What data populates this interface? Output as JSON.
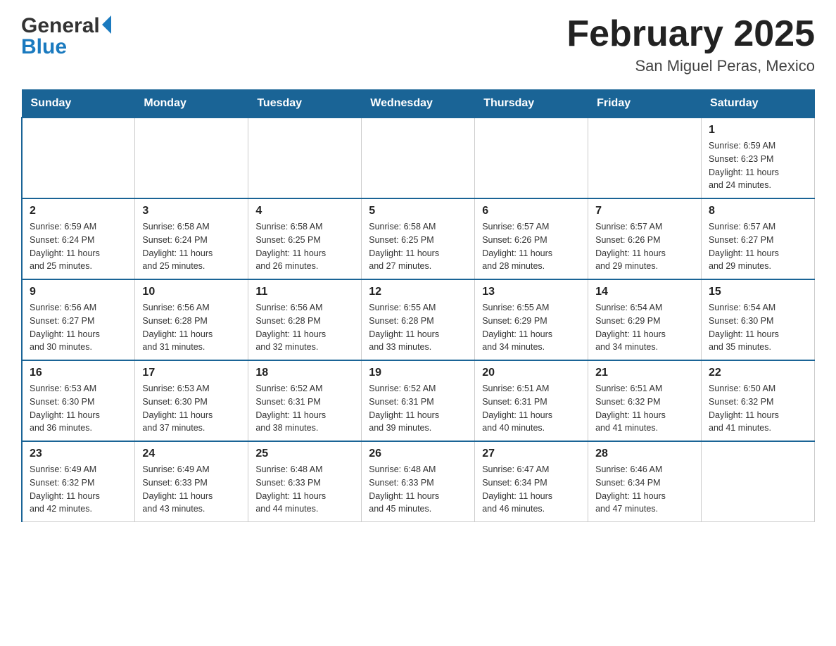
{
  "header": {
    "logo": {
      "general": "General",
      "blue": "Blue"
    },
    "title": "February 2025",
    "location": "San Miguel Peras, Mexico"
  },
  "calendar": {
    "days_of_week": [
      "Sunday",
      "Monday",
      "Tuesday",
      "Wednesday",
      "Thursday",
      "Friday",
      "Saturday"
    ],
    "weeks": [
      [
        {
          "day": "",
          "info": ""
        },
        {
          "day": "",
          "info": ""
        },
        {
          "day": "",
          "info": ""
        },
        {
          "day": "",
          "info": ""
        },
        {
          "day": "",
          "info": ""
        },
        {
          "day": "",
          "info": ""
        },
        {
          "day": "1",
          "info": "Sunrise: 6:59 AM\nSunset: 6:23 PM\nDaylight: 11 hours\nand 24 minutes."
        }
      ],
      [
        {
          "day": "2",
          "info": "Sunrise: 6:59 AM\nSunset: 6:24 PM\nDaylight: 11 hours\nand 25 minutes."
        },
        {
          "day": "3",
          "info": "Sunrise: 6:58 AM\nSunset: 6:24 PM\nDaylight: 11 hours\nand 25 minutes."
        },
        {
          "day": "4",
          "info": "Sunrise: 6:58 AM\nSunset: 6:25 PM\nDaylight: 11 hours\nand 26 minutes."
        },
        {
          "day": "5",
          "info": "Sunrise: 6:58 AM\nSunset: 6:25 PM\nDaylight: 11 hours\nand 27 minutes."
        },
        {
          "day": "6",
          "info": "Sunrise: 6:57 AM\nSunset: 6:26 PM\nDaylight: 11 hours\nand 28 minutes."
        },
        {
          "day": "7",
          "info": "Sunrise: 6:57 AM\nSunset: 6:26 PM\nDaylight: 11 hours\nand 29 minutes."
        },
        {
          "day": "8",
          "info": "Sunrise: 6:57 AM\nSunset: 6:27 PM\nDaylight: 11 hours\nand 29 minutes."
        }
      ],
      [
        {
          "day": "9",
          "info": "Sunrise: 6:56 AM\nSunset: 6:27 PM\nDaylight: 11 hours\nand 30 minutes."
        },
        {
          "day": "10",
          "info": "Sunrise: 6:56 AM\nSunset: 6:28 PM\nDaylight: 11 hours\nand 31 minutes."
        },
        {
          "day": "11",
          "info": "Sunrise: 6:56 AM\nSunset: 6:28 PM\nDaylight: 11 hours\nand 32 minutes."
        },
        {
          "day": "12",
          "info": "Sunrise: 6:55 AM\nSunset: 6:28 PM\nDaylight: 11 hours\nand 33 minutes."
        },
        {
          "day": "13",
          "info": "Sunrise: 6:55 AM\nSunset: 6:29 PM\nDaylight: 11 hours\nand 34 minutes."
        },
        {
          "day": "14",
          "info": "Sunrise: 6:54 AM\nSunset: 6:29 PM\nDaylight: 11 hours\nand 34 minutes."
        },
        {
          "day": "15",
          "info": "Sunrise: 6:54 AM\nSunset: 6:30 PM\nDaylight: 11 hours\nand 35 minutes."
        }
      ],
      [
        {
          "day": "16",
          "info": "Sunrise: 6:53 AM\nSunset: 6:30 PM\nDaylight: 11 hours\nand 36 minutes."
        },
        {
          "day": "17",
          "info": "Sunrise: 6:53 AM\nSunset: 6:30 PM\nDaylight: 11 hours\nand 37 minutes."
        },
        {
          "day": "18",
          "info": "Sunrise: 6:52 AM\nSunset: 6:31 PM\nDaylight: 11 hours\nand 38 minutes."
        },
        {
          "day": "19",
          "info": "Sunrise: 6:52 AM\nSunset: 6:31 PM\nDaylight: 11 hours\nand 39 minutes."
        },
        {
          "day": "20",
          "info": "Sunrise: 6:51 AM\nSunset: 6:31 PM\nDaylight: 11 hours\nand 40 minutes."
        },
        {
          "day": "21",
          "info": "Sunrise: 6:51 AM\nSunset: 6:32 PM\nDaylight: 11 hours\nand 41 minutes."
        },
        {
          "day": "22",
          "info": "Sunrise: 6:50 AM\nSunset: 6:32 PM\nDaylight: 11 hours\nand 41 minutes."
        }
      ],
      [
        {
          "day": "23",
          "info": "Sunrise: 6:49 AM\nSunset: 6:32 PM\nDaylight: 11 hours\nand 42 minutes."
        },
        {
          "day": "24",
          "info": "Sunrise: 6:49 AM\nSunset: 6:33 PM\nDaylight: 11 hours\nand 43 minutes."
        },
        {
          "day": "25",
          "info": "Sunrise: 6:48 AM\nSunset: 6:33 PM\nDaylight: 11 hours\nand 44 minutes."
        },
        {
          "day": "26",
          "info": "Sunrise: 6:48 AM\nSunset: 6:33 PM\nDaylight: 11 hours\nand 45 minutes."
        },
        {
          "day": "27",
          "info": "Sunrise: 6:47 AM\nSunset: 6:34 PM\nDaylight: 11 hours\nand 46 minutes."
        },
        {
          "day": "28",
          "info": "Sunrise: 6:46 AM\nSunset: 6:34 PM\nDaylight: 11 hours\nand 47 minutes."
        },
        {
          "day": "",
          "info": ""
        }
      ]
    ]
  }
}
